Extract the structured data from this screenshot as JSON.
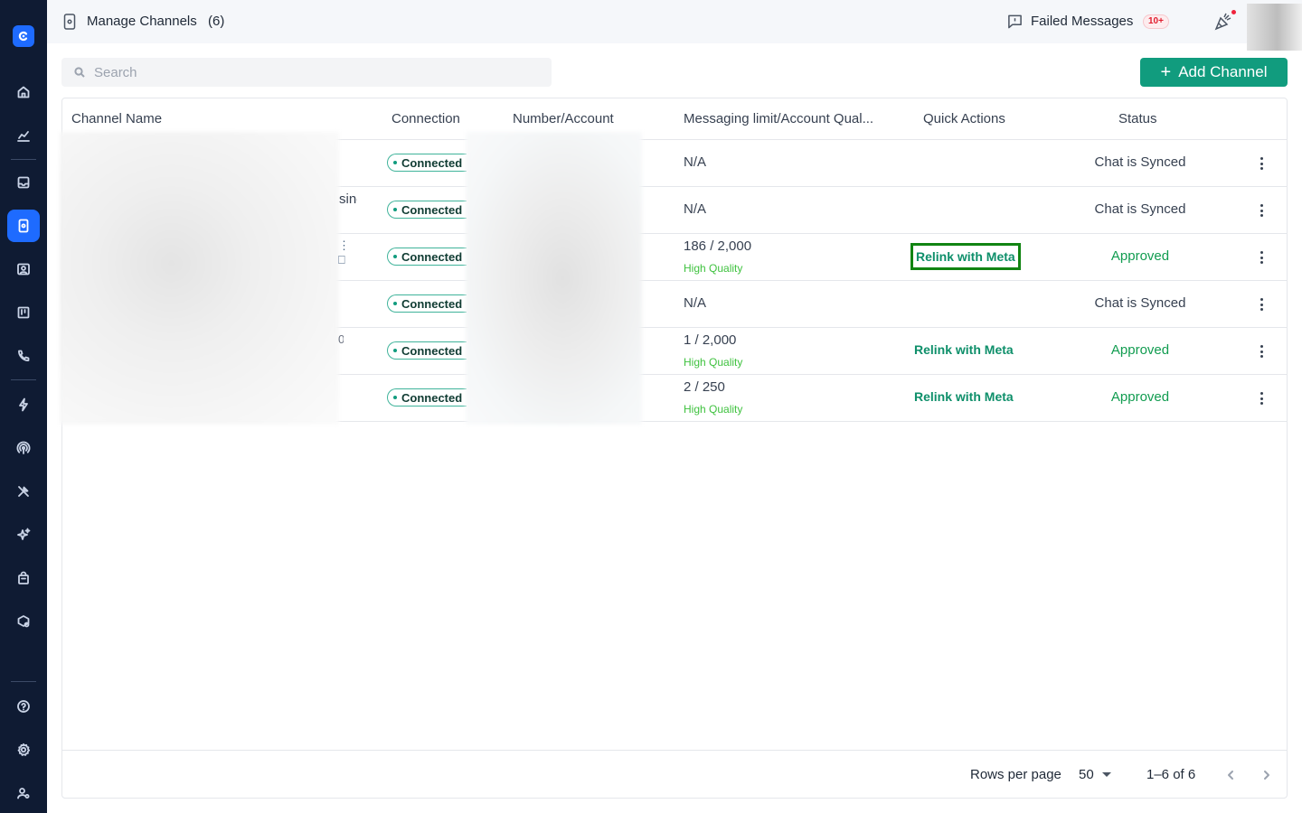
{
  "header": {
    "title": "Manage Channels",
    "count": "(6)",
    "failed_messages_label": "Failed Messages",
    "failed_badge": "10+"
  },
  "search": {
    "placeholder": "Search"
  },
  "add_button": {
    "plus": "+",
    "label": "Add Channel"
  },
  "table": {
    "columns": [
      "Channel Name",
      "Connection",
      "Number/Account",
      "Messaging limit/Account Qual...",
      "Quick Actions",
      "Status"
    ],
    "rows": [
      {
        "connection": "Connected",
        "limit": "N/A",
        "quality": "",
        "action": "",
        "status": "Chat is Synced"
      },
      {
        "connection": "Connected",
        "limit": "N/A",
        "quality": "",
        "action": "",
        "status": "Chat is Synced"
      },
      {
        "connection": "Connected",
        "limit": "186 / 2,000",
        "quality": "High Quality",
        "action": "Relink with Meta",
        "status": "Approved"
      },
      {
        "connection": "Connected",
        "limit": "N/A",
        "quality": "",
        "action": "",
        "status": "Chat is Synced"
      },
      {
        "connection": "Connected",
        "limit": "1 / 2,000",
        "quality": "High Quality",
        "action": "Relink with Meta",
        "status": "Approved"
      },
      {
        "connection": "Connected",
        "limit": "2 / 250",
        "quality": "High Quality",
        "action": "Relink with Meta",
        "status": "Approved"
      }
    ],
    "peek_texts": [
      "sine",
      "⋮ ⎕",
      "0"
    ]
  },
  "footer": {
    "rows_per_page_label": "Rows per page",
    "rows_per_page_value": "50",
    "range": "1–6 of 6"
  },
  "colors": {
    "sidebar_bg": "#0f1b33",
    "accent": "#1e6bff",
    "primary_green": "#119c7e",
    "approved": "#119c50",
    "high_quality": "#3fc23f"
  },
  "sidebar": {
    "icons": [
      "home-icon",
      "analytics-icon",
      "inbox-icon",
      "channels-icon",
      "contacts-icon",
      "board-icon",
      "phone-icon",
      "automation-icon",
      "broadcast-icon",
      "tools-icon",
      "ai-sparkle-icon",
      "commerce-icon",
      "integrations-icon",
      "help-icon",
      "settings-icon",
      "user-settings-icon"
    ],
    "active": "channels-icon"
  }
}
